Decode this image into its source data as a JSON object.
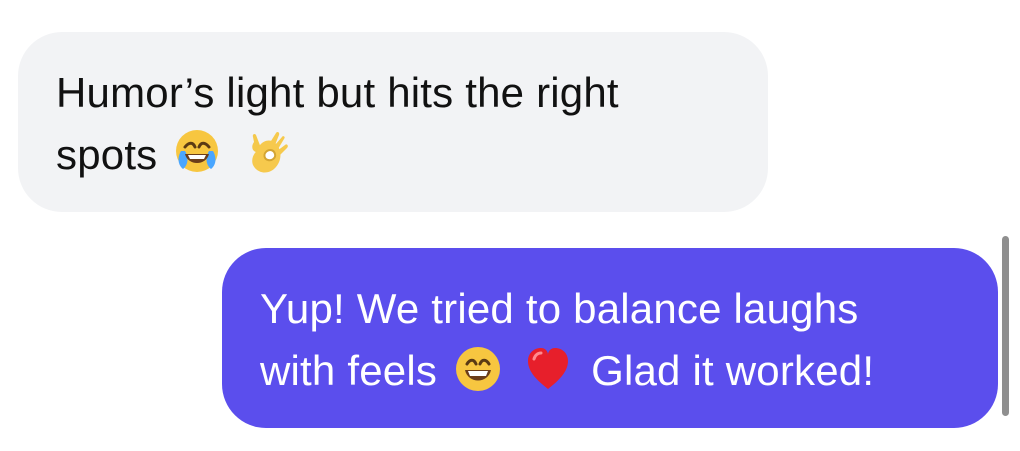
{
  "messages": [
    {
      "direction": "incoming",
      "line1": "Humor’s light but hits the right",
      "line2": "spots",
      "emojis": [
        "tears-of-joy-emoji",
        "ok-hand-emoji"
      ]
    },
    {
      "direction": "outgoing",
      "line1": "Yup! We tried to balance laughs",
      "line2_prefix": "with feels",
      "line2_suffix": "Glad it worked!",
      "emojis": [
        "grinning-face-emoji",
        "red-heart-emoji"
      ]
    }
  ],
  "colors": {
    "incoming_bubble": "#f2f3f5",
    "incoming_text": "#111111",
    "outgoing_bubble": "#5b4eed",
    "outgoing_text": "#ffffff",
    "scrollbar": "#8f8f8f"
  }
}
